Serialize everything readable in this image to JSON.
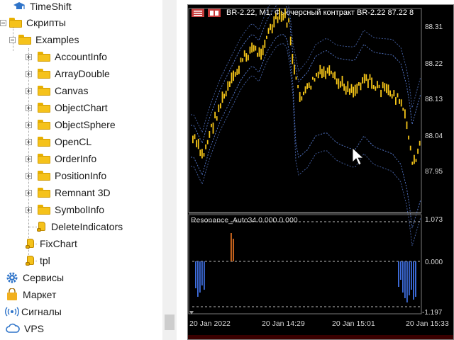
{
  "navigator": {
    "items": [
      {
        "label": "TimeShift",
        "icon": "graduation-cap-icon"
      },
      {
        "label": "Скрипты",
        "icon": "folder-icon"
      },
      {
        "label": "Examples",
        "icon": "folder-icon"
      },
      {
        "label": "AccountInfo",
        "icon": "folder-icon"
      },
      {
        "label": "ArrayDouble",
        "icon": "folder-icon"
      },
      {
        "label": "Canvas",
        "icon": "folder-icon"
      },
      {
        "label": "ObjectChart",
        "icon": "folder-icon"
      },
      {
        "label": "ObjectSphere",
        "icon": "folder-icon"
      },
      {
        "label": "OpenCL",
        "icon": "folder-icon"
      },
      {
        "label": "OrderInfo",
        "icon": "folder-icon"
      },
      {
        "label": "PositionInfo",
        "icon": "folder-icon"
      },
      {
        "label": "Remnant 3D",
        "icon": "folder-icon"
      },
      {
        "label": "SymbolInfo",
        "icon": "folder-icon"
      },
      {
        "label": "DeleteIndicators",
        "icon": "script-icon"
      },
      {
        "label": "FixChart",
        "icon": "script-icon"
      },
      {
        "label": "tpl",
        "icon": "script-icon"
      },
      {
        "label": "Сервисы",
        "icon": "gear-icon"
      },
      {
        "label": "Маркет",
        "icon": "shopping-bag-icon"
      },
      {
        "label": "Сигналы",
        "icon": "signal-icon"
      },
      {
        "label": "VPS",
        "icon": "cloud-icon"
      }
    ]
  },
  "chart": {
    "header": "BR-2.22, M1:  Фьючерсный контракт BR-2.22   87.22 8",
    "price_labels": [
      "88.31",
      "88.22",
      "88.13",
      "88.04",
      "87.95"
    ],
    "indicator_title": "Resonance_Auto34 0.000 0.000",
    "indicator_labels": [
      "1.073",
      "0.000",
      "-1.197"
    ],
    "time_labels": [
      "20 Jan 2022",
      "20 Jan 14:29",
      "20 Jan 15:01",
      "20 Jan 15:33"
    ],
    "colors": {
      "background": "#000000",
      "candle": "#f5c518",
      "band": "#5a7fd8",
      "histogram_negative": "#3f6fe0",
      "histogram_positive": "#e07020"
    }
  }
}
